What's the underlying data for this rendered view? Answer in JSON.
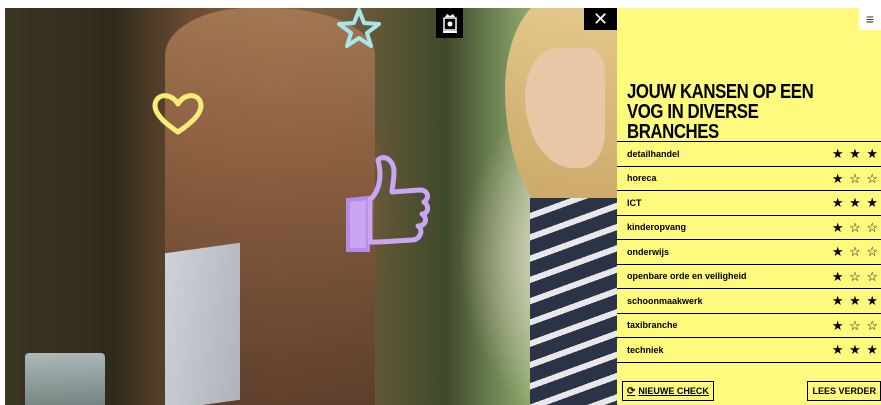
{
  "hero": {
    "doodles": [
      "star-doodle",
      "heart-doodle",
      "thumbs-up-doodle"
    ]
  },
  "header": {
    "close_glyph": "✕",
    "menu_glyph": "≡"
  },
  "panel": {
    "title": "JOUW KANSEN OP EEN VOG IN DIVERSE BRANCHES",
    "rows": [
      {
        "label": "detailhandel",
        "stars": "★ ★ ★",
        "rating": 3
      },
      {
        "label": "horeca",
        "stars": "★ ☆ ☆",
        "rating": 1
      },
      {
        "label": "ICT",
        "stars": "★ ★ ★",
        "rating": 3
      },
      {
        "label": "kinderopvang",
        "stars": "★ ☆ ☆",
        "rating": 1
      },
      {
        "label": "onderwijs",
        "stars": "★ ☆ ☆",
        "rating": 1
      },
      {
        "label": "openbare orde en veiligheid",
        "stars": "★ ☆ ☆",
        "rating": 1
      },
      {
        "label": "schoonmaakwerk",
        "stars": "★ ★ ★",
        "rating": 3
      },
      {
        "label": "taxibranche",
        "stars": "★ ☆ ☆",
        "rating": 1
      },
      {
        "label": "techniek",
        "stars": "★ ★ ★",
        "rating": 3
      }
    ],
    "new_check_label": "NIEUWE CHECK",
    "new_check_icon": "refresh-icon",
    "read_more_label": "LEES VERDER"
  },
  "colors": {
    "panel_bg": "#fdfa7d",
    "accent": "#000000"
  }
}
